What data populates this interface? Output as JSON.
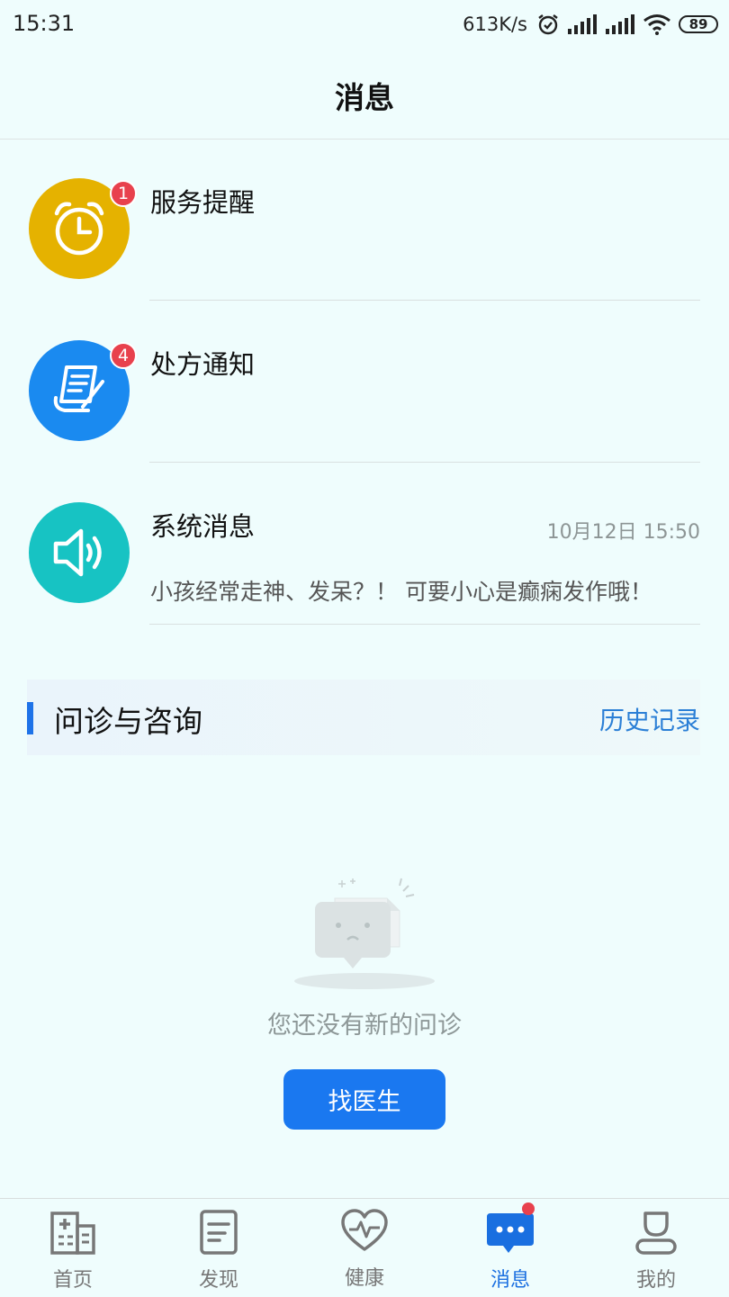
{
  "status_bar": {
    "time": "15:31",
    "net_speed": "613K/s",
    "battery": "89"
  },
  "header": {
    "title": "消息"
  },
  "messages": [
    {
      "title": "服务提醒",
      "badge": "1",
      "icon": "alarm-clock-icon",
      "color": "#e5b200"
    },
    {
      "title": "处方通知",
      "badge": "4",
      "icon": "prescription-icon",
      "color": "#1a8af0"
    },
    {
      "title": "系统消息",
      "time": "10月12日 15:50",
      "preview": "小孩经常走神、发呆？！ 可要小心是癫痫发作哦！",
      "icon": "speaker-icon",
      "color": "#17c3c3"
    }
  ],
  "consult": {
    "title": "问诊与咨询",
    "history": "历史记录",
    "empty_text": "您还没有新的问诊",
    "find_doctor": "找医生"
  },
  "tabs": [
    {
      "label": "首页",
      "icon": "hospital-icon"
    },
    {
      "label": "发现",
      "icon": "document-icon"
    },
    {
      "label": "健康",
      "icon": "heart-pulse-icon"
    },
    {
      "label": "消息",
      "icon": "chat-bubble-icon",
      "active": true
    },
    {
      "label": "我的",
      "icon": "person-icon"
    }
  ],
  "colors": {
    "accent": "#1a78f0",
    "badge": "#e8414d",
    "background": "#effdfd"
  }
}
